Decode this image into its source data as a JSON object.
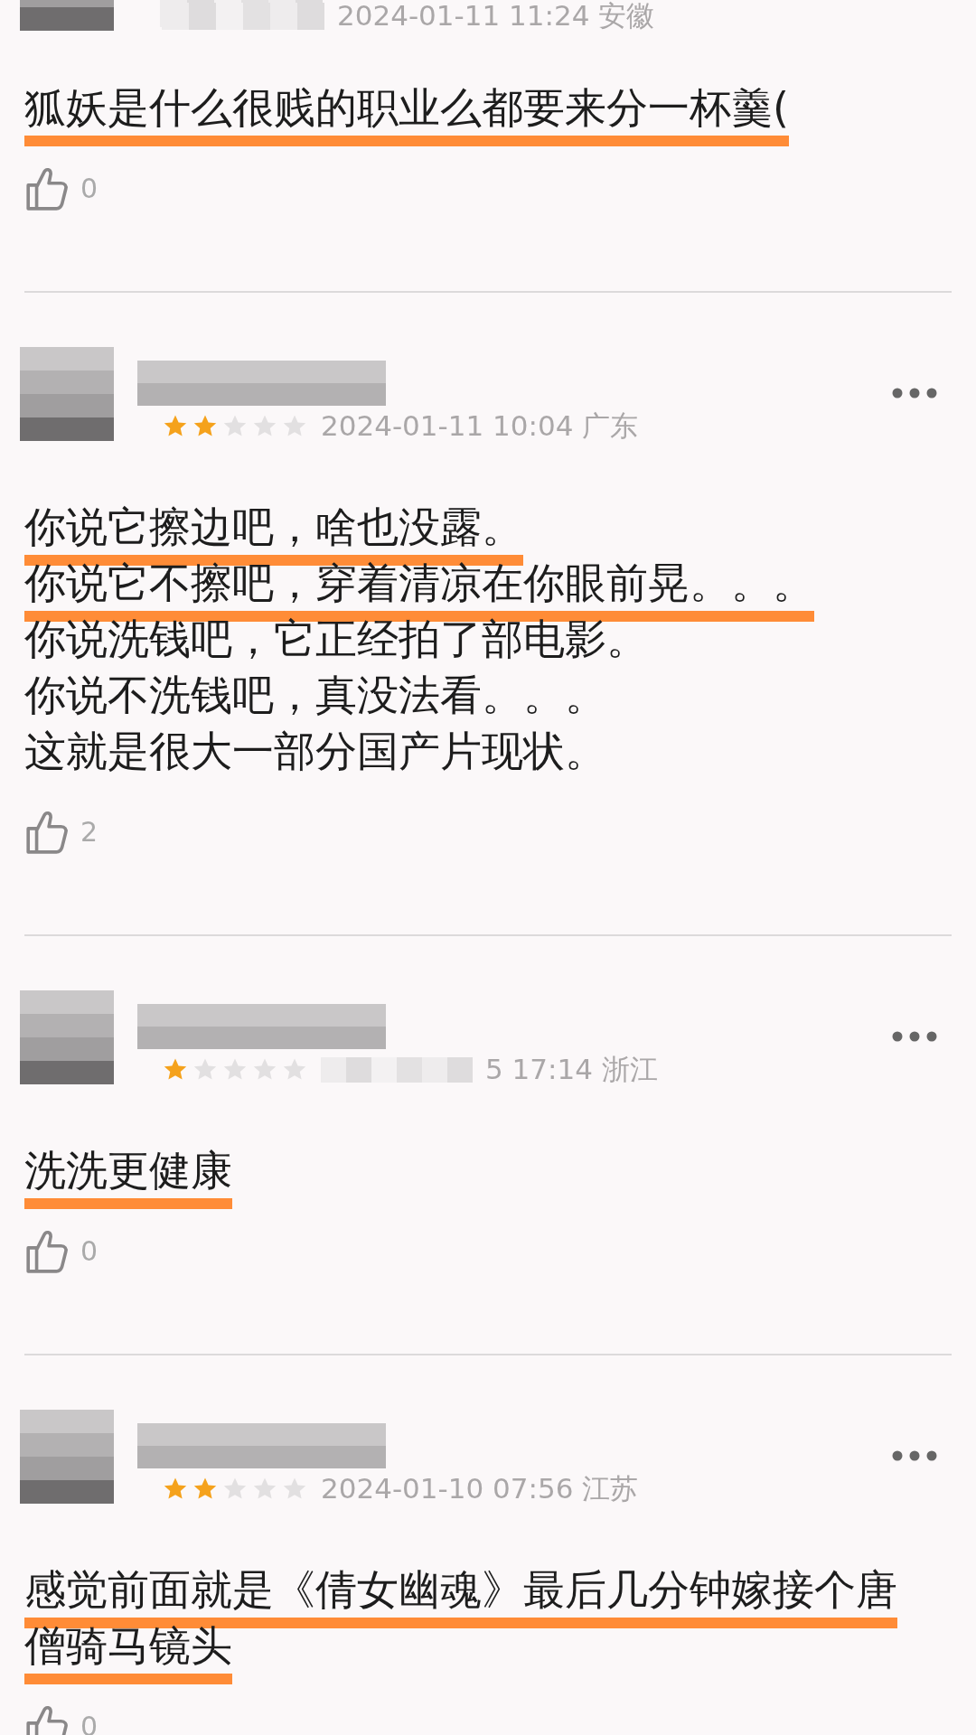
{
  "comments": [
    {
      "date": "2024-01-11 11:24 安徽",
      "date_blurred": false,
      "lines": [
        {
          "text": "狐妖是什么很贱的职业么都要来分一杯羹(",
          "underlined": true
        }
      ],
      "likes": "0",
      "more_menu": false
    },
    {
      "stars": 2,
      "date": "2024-01-11 10:04 广东",
      "date_blurred": false,
      "lines": [
        {
          "text": "你说它擦边吧，啥也没露。",
          "underlined": true
        },
        {
          "text": "你说它不擦吧，穿着清凉在你眼前晃。。。",
          "underlined": true
        },
        {
          "text": "你说洗钱吧，它正经拍了部电影。",
          "underlined": false
        },
        {
          "text": "你说不洗钱吧，真没法看。。。",
          "underlined": false
        },
        {
          "text": "这就是很大一部分国产片现状。",
          "underlined": false
        }
      ],
      "likes": "2",
      "more_menu": true
    },
    {
      "stars": 1,
      "date": "5 17:14 浙江",
      "date_blurred": true,
      "lines": [
        {
          "text": "洗洗更健康",
          "underlined": true
        }
      ],
      "likes": "0",
      "more_menu": true
    },
    {
      "stars": 2,
      "date": "2024-01-10 07:56 江苏",
      "date_blurred": false,
      "lines": [
        {
          "text": "感觉前面就是《倩女幽魂》最后几分钟嫁接个唐",
          "underlined": true
        },
        {
          "text": "僧骑马镜头",
          "underlined": true
        }
      ],
      "likes": "0",
      "more_menu": true
    }
  ]
}
